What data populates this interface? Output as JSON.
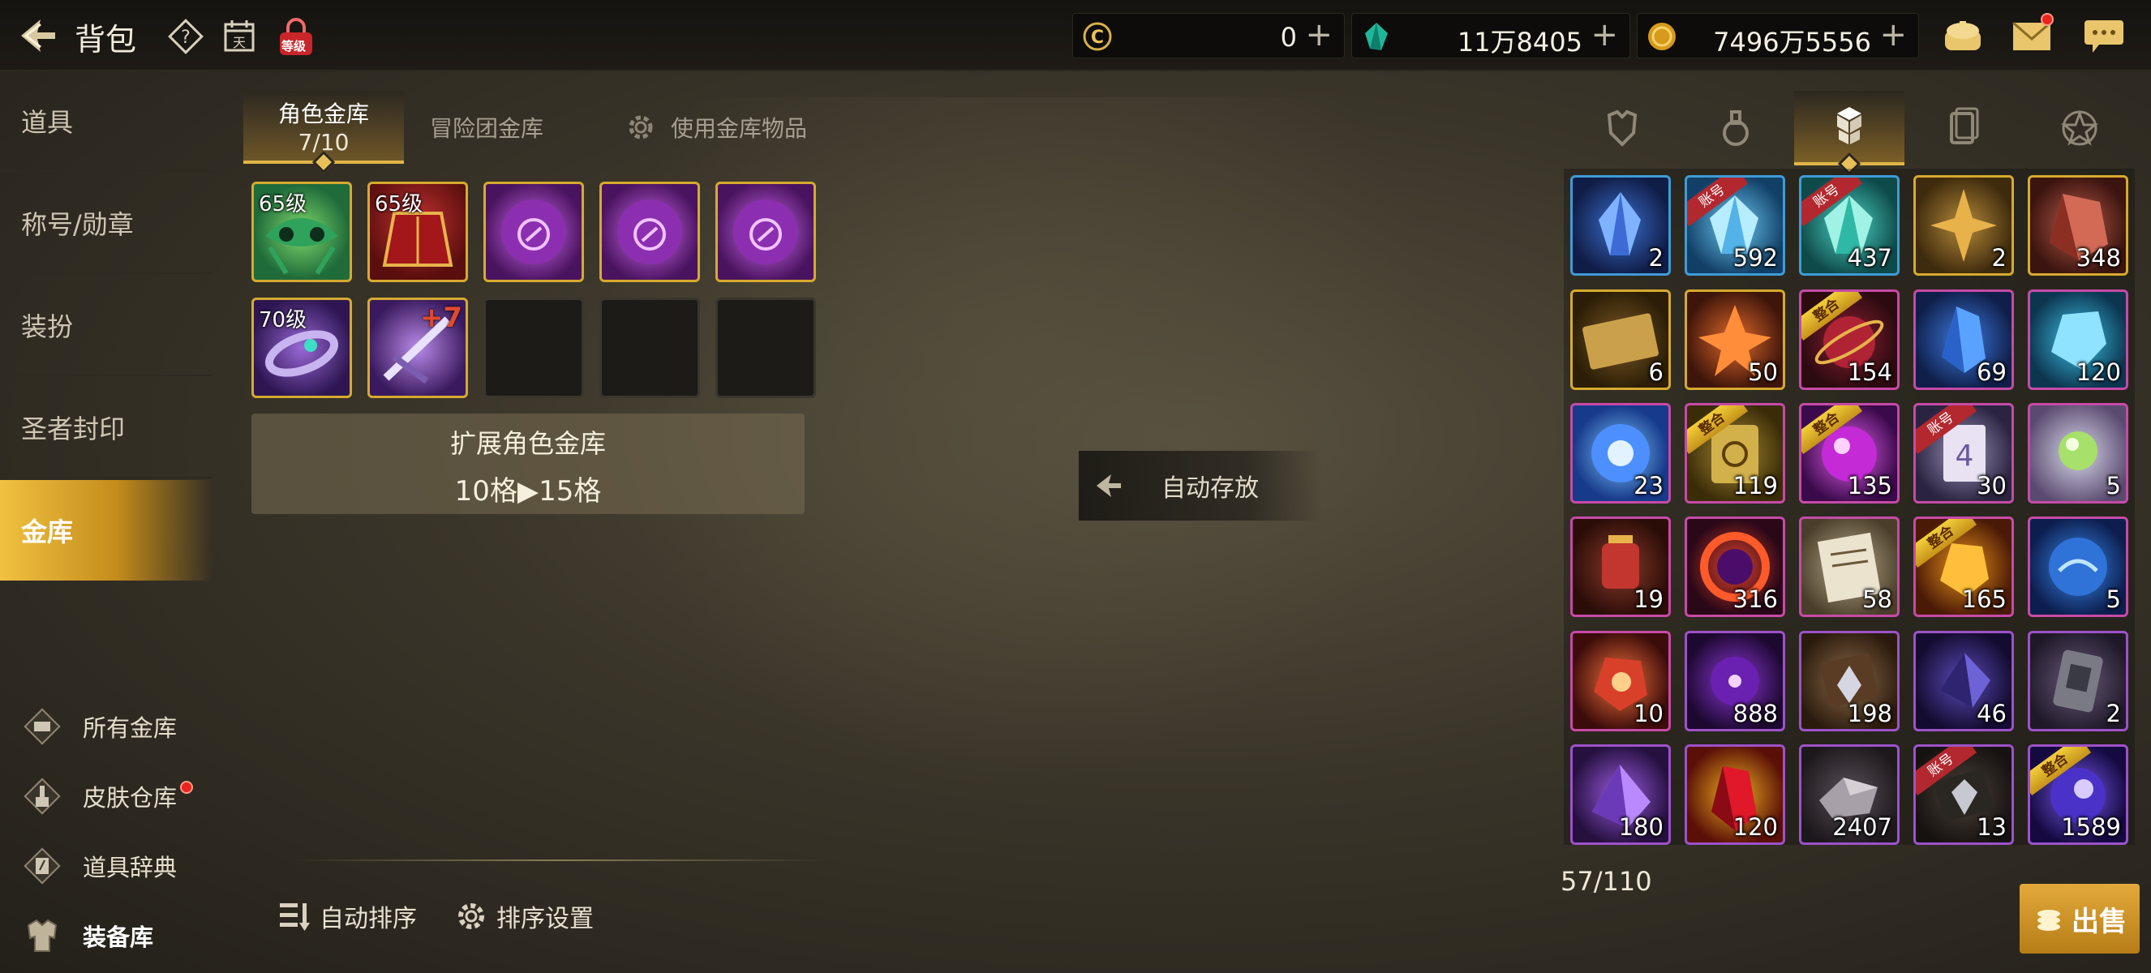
{
  "header": {
    "title": "背包",
    "level_badge": "等级",
    "currencies": [
      {
        "icon": "c-coin-icon",
        "value": "0"
      },
      {
        "icon": "teal-crystal-icon",
        "value": "11万8405"
      },
      {
        "icon": "gold-coin-icon",
        "value": "7496万5556"
      }
    ]
  },
  "sidebar": {
    "items": [
      {
        "label": "道具"
      },
      {
        "label": "称号/勋章"
      },
      {
        "label": "装扮"
      },
      {
        "label": "圣者封印"
      },
      {
        "label": "金库"
      }
    ],
    "vault_links": [
      {
        "label": "所有金库"
      },
      {
        "label": "皮肤仓库"
      },
      {
        "label": "道具辞典"
      },
      {
        "label": "装备库"
      }
    ]
  },
  "vault": {
    "tabs": {
      "character": "角色金库",
      "character_count": "7/10",
      "adventure": "冒险团金库",
      "use_items": "使用金库物品"
    },
    "slots": [
      {
        "level": "65级",
        "plus": ""
      },
      {
        "level": "65级",
        "plus": ""
      },
      {
        "level": "",
        "plus": ""
      },
      {
        "level": "",
        "plus": ""
      },
      {
        "level": "",
        "plus": ""
      },
      {
        "level": "70级",
        "plus": ""
      },
      {
        "level": "",
        "plus": "+7"
      }
    ],
    "expand_title": "扩展角色金库",
    "expand_detail": "10格▶15格",
    "auto_store": "自动存放",
    "auto_sort": "自动排序",
    "sort_settings": "排序设置"
  },
  "inventory": {
    "tags": {
      "account": "账号",
      "merge": "整合"
    },
    "items": [
      {
        "count": "2"
      },
      {
        "count": "592"
      },
      {
        "count": "437"
      },
      {
        "count": "2"
      },
      {
        "count": "348"
      },
      {
        "count": "6"
      },
      {
        "count": "50"
      },
      {
        "count": "154"
      },
      {
        "count": "69"
      },
      {
        "count": "120"
      },
      {
        "count": "23"
      },
      {
        "count": "119"
      },
      {
        "count": "135"
      },
      {
        "count": "30"
      },
      {
        "count": "5"
      },
      {
        "count": "19"
      },
      {
        "count": "316"
      },
      {
        "count": "58"
      },
      {
        "count": "165"
      },
      {
        "count": "5"
      },
      {
        "count": "10"
      },
      {
        "count": "888"
      },
      {
        "count": "198"
      },
      {
        "count": "46"
      },
      {
        "count": "2"
      },
      {
        "count": "180"
      },
      {
        "count": "120"
      },
      {
        "count": "2407"
      },
      {
        "count": "13"
      },
      {
        "count": "1589"
      }
    ],
    "capacity": "57/110",
    "sell_label": "出售"
  }
}
